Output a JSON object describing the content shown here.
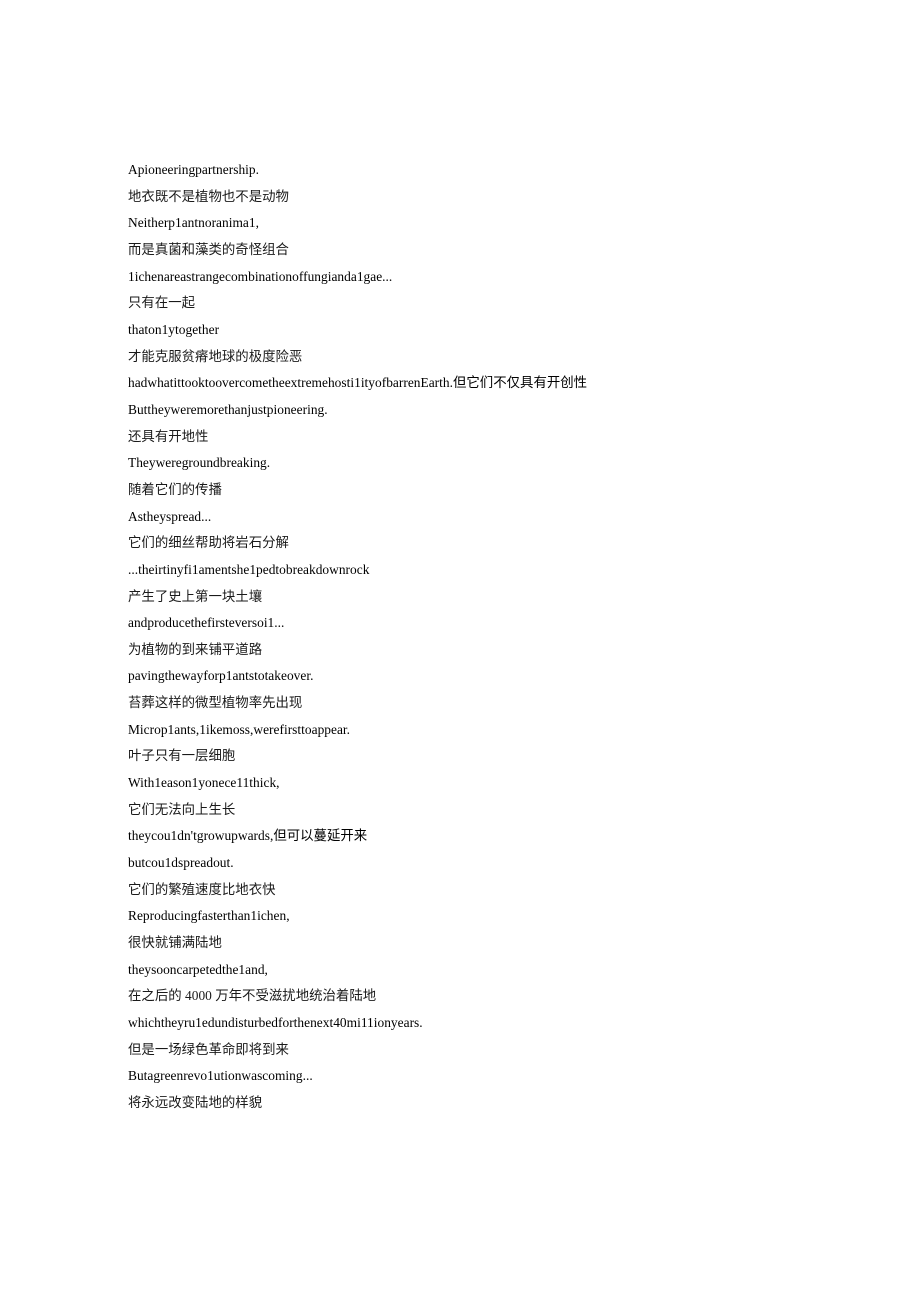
{
  "document": {
    "lines": [
      {
        "id": "line-1",
        "lang": "en",
        "text": "Apioneeringpartnership."
      },
      {
        "id": "line-2",
        "lang": "zh",
        "text": "地衣既不是植物也不是动物"
      },
      {
        "id": "line-3",
        "lang": "en",
        "text": "Neitherp1antnoranima1,"
      },
      {
        "id": "line-4",
        "lang": "zh",
        "text": "而是真菌和藻类的奇怪组合"
      },
      {
        "id": "line-5",
        "lang": "en",
        "text": "1ichenareastrangecombinationoffungianda1gae..."
      },
      {
        "id": "line-6",
        "lang": "zh",
        "text": "只有在一起"
      },
      {
        "id": "line-7",
        "lang": "en",
        "text": "thaton1ytogether"
      },
      {
        "id": "line-8",
        "lang": "zh",
        "text": "才能克服贫瘠地球的极度险恶"
      },
      {
        "id": "line-9",
        "lang": "mixed",
        "text": "hadwhatittooktoovercometheextremehosti1ityofbarrenEarth.但它们不仅具有开创性"
      },
      {
        "id": "line-10",
        "lang": "en",
        "text": "Buttheyweremorethanjustpioneering."
      },
      {
        "id": "line-11",
        "lang": "zh",
        "text": "还具有开地性"
      },
      {
        "id": "line-12",
        "lang": "en",
        "text": "Theyweregroundbreaking."
      },
      {
        "id": "line-13",
        "lang": "zh",
        "text": "随着它们的传播"
      },
      {
        "id": "line-14",
        "lang": "en",
        "text": "Astheyspread..."
      },
      {
        "id": "line-15",
        "lang": "zh",
        "text": "它们的细丝帮助将岩石分解"
      },
      {
        "id": "line-16",
        "lang": "en",
        "text": "...theirtinyfi1amentshe1pedtobreakdownrock"
      },
      {
        "id": "line-17",
        "lang": "zh",
        "text": "产生了史上第一块土壤"
      },
      {
        "id": "line-18",
        "lang": "en",
        "text": "andproducethefirsteversoi1..."
      },
      {
        "id": "line-19",
        "lang": "zh",
        "text": "为植物的到来铺平道路"
      },
      {
        "id": "line-20",
        "lang": "en",
        "text": "pavingthewayforp1antstotakeover."
      },
      {
        "id": "line-21",
        "lang": "zh",
        "text": "苔葬这样的微型植物率先出现"
      },
      {
        "id": "line-22",
        "lang": "en",
        "text": "Microp1ants,1ikemoss,werefirsttoappear."
      },
      {
        "id": "line-23",
        "lang": "zh",
        "text": "叶子只有一层细胞"
      },
      {
        "id": "line-24",
        "lang": "en",
        "text": "With1eason1yonece11thick,"
      },
      {
        "id": "line-25",
        "lang": "zh",
        "text": "它们无法向上生长"
      },
      {
        "id": "line-26",
        "lang": "mixed",
        "text": "theycou1dn'tgrowupwards,但可以蔓延开来"
      },
      {
        "id": "line-27",
        "lang": "en",
        "text": "butcou1dspreadout."
      },
      {
        "id": "line-28",
        "lang": "zh",
        "text": "它们的繁殖速度比地衣快"
      },
      {
        "id": "line-29",
        "lang": "en",
        "text": "Reproducingfasterthan1ichen,"
      },
      {
        "id": "line-30",
        "lang": "zh",
        "text": "很快就铺满陆地"
      },
      {
        "id": "line-31",
        "lang": "en",
        "text": "theysooncarpetedthe1and,"
      },
      {
        "id": "line-32",
        "lang": "zh",
        "text": "在之后的 4000 万年不受滋扰地统治着陆地"
      },
      {
        "id": "line-33",
        "lang": "en",
        "text": "whichtheyru1edundisturbedforthenext40mi11ionyears."
      },
      {
        "id": "line-34",
        "lang": "zh",
        "text": "但是一场绿色革命即将到来"
      },
      {
        "id": "line-35",
        "lang": "en",
        "text": "Butagreenrevo1utionwascoming..."
      },
      {
        "id": "line-36",
        "lang": "zh",
        "text": "将永远改变陆地的样貌"
      }
    ]
  }
}
